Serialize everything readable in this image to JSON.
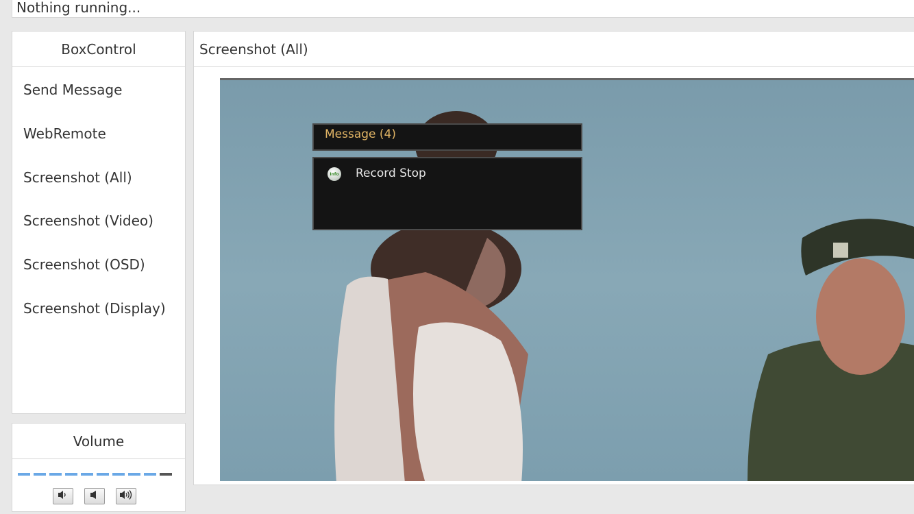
{
  "status": {
    "text": "Nothing running..."
  },
  "boxcontrol": {
    "title": "BoxControl",
    "items": [
      {
        "label": "Send Message"
      },
      {
        "label": "WebRemote"
      },
      {
        "label": "Screenshot (All)"
      },
      {
        "label": "Screenshot (Video)"
      },
      {
        "label": "Screenshot (OSD)"
      },
      {
        "label": "Screenshot (Display)"
      }
    ]
  },
  "volume": {
    "title": "Volume",
    "level": 0.9,
    "segments_active": 9,
    "segments_total": 10,
    "buttons": [
      {
        "icon": "volume-down-icon"
      },
      {
        "icon": "mute-icon"
      },
      {
        "icon": "volume-up-icon"
      }
    ]
  },
  "screenshot": {
    "title": "Screenshot (All)",
    "osd": {
      "title": "Message (4)",
      "icon_label": "Info",
      "message": "Record Stop"
    }
  },
  "colors": {
    "accent": "#6aa8e6",
    "osd_title": "#e2b565",
    "osd_background": "#141414",
    "page_background": "#e8e8e8"
  }
}
